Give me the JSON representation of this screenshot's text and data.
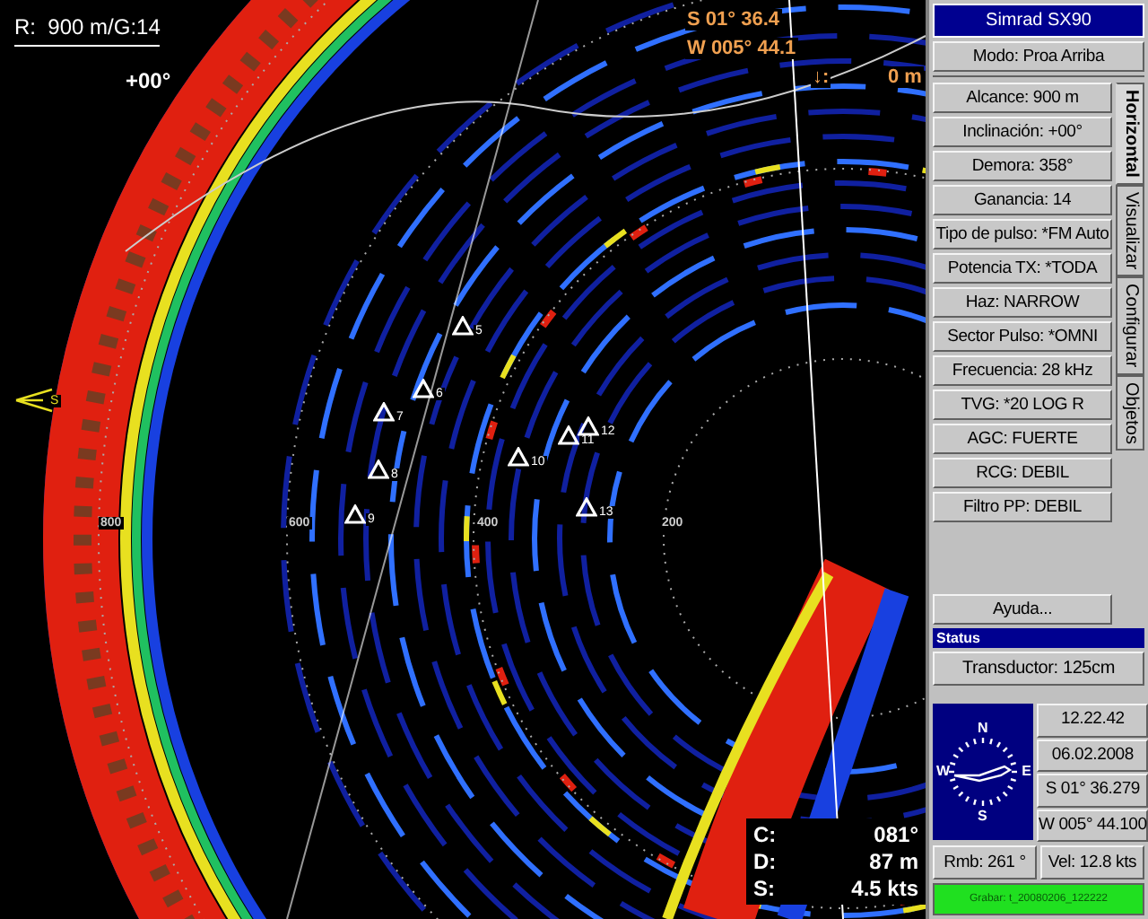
{
  "sonar": {
    "range_gain": "R:  900 m/G:14",
    "tilt": "+00°",
    "position_lat": "S 01° 36.4",
    "position_lon": "W 005° 44.1",
    "depth_label": "↓:",
    "depth": "0 m",
    "range_labels": [
      "800",
      "600",
      "400",
      "200"
    ],
    "waypoint_label": "S",
    "markers": [
      {
        "label": "5"
      },
      {
        "label": "6"
      },
      {
        "label": "7"
      },
      {
        "label": "8"
      },
      {
        "label": "9"
      },
      {
        "label": "10"
      },
      {
        "label": "11"
      },
      {
        "label": "12"
      },
      {
        "label": "13"
      }
    ],
    "readouts": [
      {
        "label": "C:",
        "value": "081°"
      },
      {
        "label": "D:",
        "value": "87 m"
      },
      {
        "label": "S:",
        "value": "4.5 kts"
      }
    ]
  },
  "panel": {
    "title": "Simrad SX90",
    "mode": "Modo: Proa Arriba",
    "settings": [
      "Alcance: 900 m",
      "Inclinación: +00°",
      "Demora: 358°",
      "Ganancia: 14",
      "Tipo de pulso: *FM Auto",
      "Potencia TX: *TODA",
      "Haz: NARROW",
      "Sector Pulso: *OMNI",
      "Frecuencia: 28 kHz",
      "TVG: *20 LOG R",
      "AGC: FUERTE",
      "RCG: DEBIL",
      "Filtro PP: DEBIL"
    ],
    "tabs": [
      {
        "label": "Horizontal",
        "selected": true
      },
      {
        "label": "Visualizar",
        "selected": false
      },
      {
        "label": "Configurar",
        "selected": false
      },
      {
        "label": "Objetos",
        "selected": false
      }
    ],
    "help": "Ayuda..."
  },
  "status": {
    "title": "Status",
    "transducer": "Transductor: 125cm",
    "compass": {
      "north": "N",
      "east": "E",
      "south": "S",
      "west": "W"
    },
    "time": "12.22.42",
    "date": "06.02.2008",
    "latitude": "S 01° 36.279",
    "longitude": "W 005° 44.100",
    "bearing": "Rmb: 261 °",
    "speed": "Vel: 12.8 kts",
    "record": "Grabar: t_20080206_122222"
  }
}
